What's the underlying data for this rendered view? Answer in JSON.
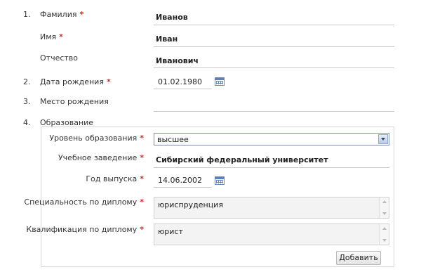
{
  "section1": {
    "number": "1.",
    "lastname_label": "Фамилия",
    "lastname_value": "Иванов",
    "firstname_label": "Имя",
    "firstname_value": "Иван",
    "middlename_label": "Отчество",
    "middlename_value": "Иванович"
  },
  "section2": {
    "number": "2.",
    "label": "Дата рождения",
    "value": "01.02.1980"
  },
  "section3": {
    "number": "3.",
    "label": "Место рождения",
    "value": ""
  },
  "section4": {
    "number": "4.",
    "label": "Образование",
    "education_level_label": "Уровень образования",
    "education_level_value": "высшее",
    "institution_label": "Учебное заведение",
    "institution_value": "Сибирский федеральный университет",
    "graduation_year_label": "Год выпуска",
    "graduation_year_value": "14.06.2002",
    "specialty_label": "Специальность по диплому",
    "specialty_value": "юриспруденция",
    "qualification_label": "Квалификация по диплому",
    "qualification_value": "юрист",
    "add_button": "Добавить"
  },
  "required_marker": "*",
  "icons": {
    "calendar": "calendar-icon",
    "dropdown": "chevron-down-icon"
  },
  "colors": {
    "required": "#d9262b",
    "select_border": "#7d8ea8"
  }
}
